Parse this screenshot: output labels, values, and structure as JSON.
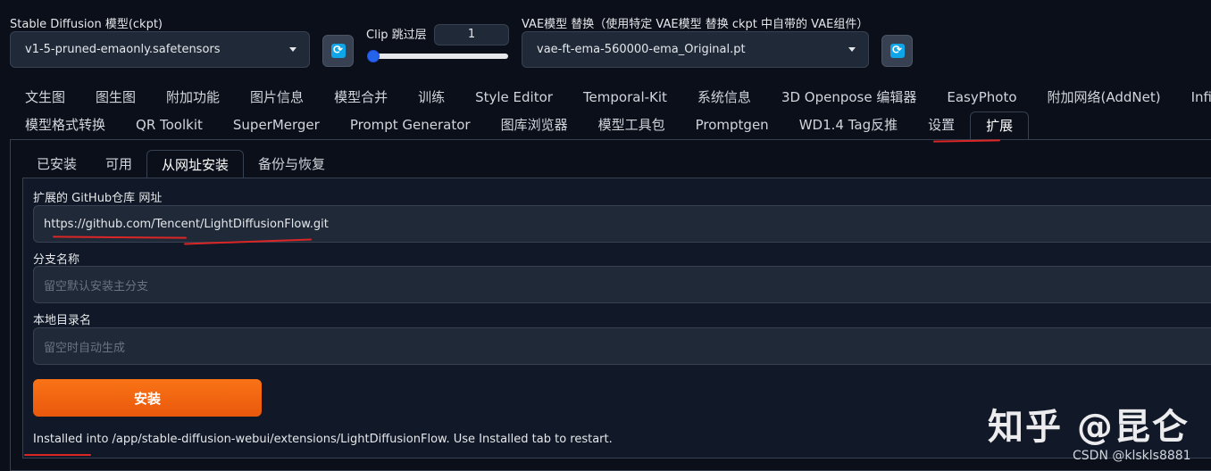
{
  "top": {
    "sd_model": {
      "label": "Stable Diffusion 模型(ckpt)",
      "value": "v1-5-pruned-emaonly.safetensors"
    },
    "clip": {
      "label": "Clip 跳过层",
      "value": "1",
      "slider_fraction": 0.0
    },
    "vae": {
      "label": "VAE模型 替换（使用特定 VAE模型 替换 ckpt 中自带的 VAE组件）",
      "value": "vae-ft-ema-560000-ema_Original.pt"
    },
    "refresh_icon": "refresh-icon"
  },
  "tabs_row1": [
    "文生图",
    "图生图",
    "附加功能",
    "图片信息",
    "模型合并",
    "训练",
    "Style Editor",
    "Temporal-Kit",
    "系统信息",
    "3D Openpose 编辑器",
    "EasyPhoto",
    "附加网络(AddNet)",
    "Infinite"
  ],
  "tabs_row2": [
    "模型格式转换",
    "QR Toolkit",
    "SuperMerger",
    "Prompt Generator",
    "图库浏览器",
    "模型工具包",
    "Promptgen",
    "WD1.4 Tag反推",
    "设置",
    "扩展"
  ],
  "active_tab": "扩展",
  "subtabs": [
    "已安装",
    "可用",
    "从网址安装",
    "备份与恢复"
  ],
  "active_subtab": "从网址安装",
  "form": {
    "url": {
      "label": "扩展的 GitHub仓库 网址",
      "value": "https://github.com/Tencent/LightDiffusionFlow.git"
    },
    "branch": {
      "label": "分支名称",
      "placeholder": "留空默认安装主分支"
    },
    "dir": {
      "label": "本地目录名",
      "placeholder": "留空时自动生成"
    },
    "install_label": "安装",
    "status": "Installed into /app/stable-diffusion-webui/extensions/LightDiffusionFlow. Use Installed tab to restart."
  },
  "watermark": {
    "main": "知乎 @昆仑",
    "sub": "CSDN @klskls8881"
  },
  "colors": {
    "background": "#0b0f19",
    "accent": "#f97316",
    "annotation": "#dc2626",
    "refresh": "#0ea5e9"
  }
}
